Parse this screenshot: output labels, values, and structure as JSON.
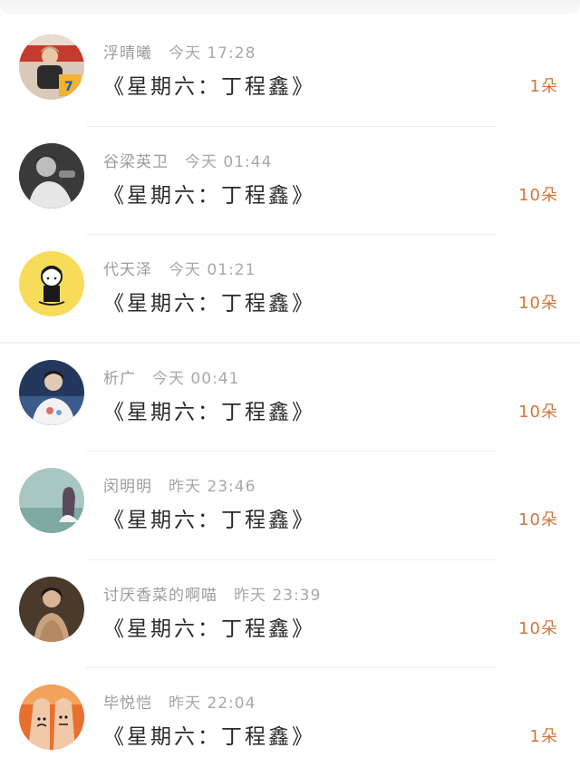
{
  "items": [
    {
      "user": "浮晴曦",
      "time": "今天 17:28",
      "title": "《星期六：丁程鑫》",
      "count": "1朵",
      "avatar_icon": "user-avatar-icon"
    },
    {
      "user": "谷梁英卫",
      "time": "今天 01:44",
      "title": "《星期六：丁程鑫》",
      "count": "10朵",
      "avatar_icon": "user-avatar-icon"
    },
    {
      "user": "代天泽",
      "time": "今天 01:21",
      "title": "《星期六：丁程鑫》",
      "count": "10朵",
      "avatar_icon": "user-avatar-icon"
    },
    {
      "user": "析广",
      "time": "今天 00:41",
      "title": "《星期六：丁程鑫》",
      "count": "10朵",
      "avatar_icon": "user-avatar-icon"
    },
    {
      "user": "闵明明",
      "time": "昨天 23:46",
      "title": "《星期六：丁程鑫》",
      "count": "10朵",
      "avatar_icon": "user-avatar-icon"
    },
    {
      "user": "讨厌香菜的啊喵",
      "time": "昨天 23:39",
      "title": "《星期六：丁程鑫》",
      "count": "10朵",
      "avatar_icon": "user-avatar-icon"
    },
    {
      "user": "毕悦恺",
      "time": "昨天 22:04",
      "title": "《星期六：丁程鑫》",
      "count": "1朵",
      "avatar_icon": "user-avatar-icon"
    }
  ],
  "colors": {
    "count_accent": "#d2763a",
    "meta_gray": "#9c9c9c",
    "title_dark": "#2a2a2a"
  }
}
